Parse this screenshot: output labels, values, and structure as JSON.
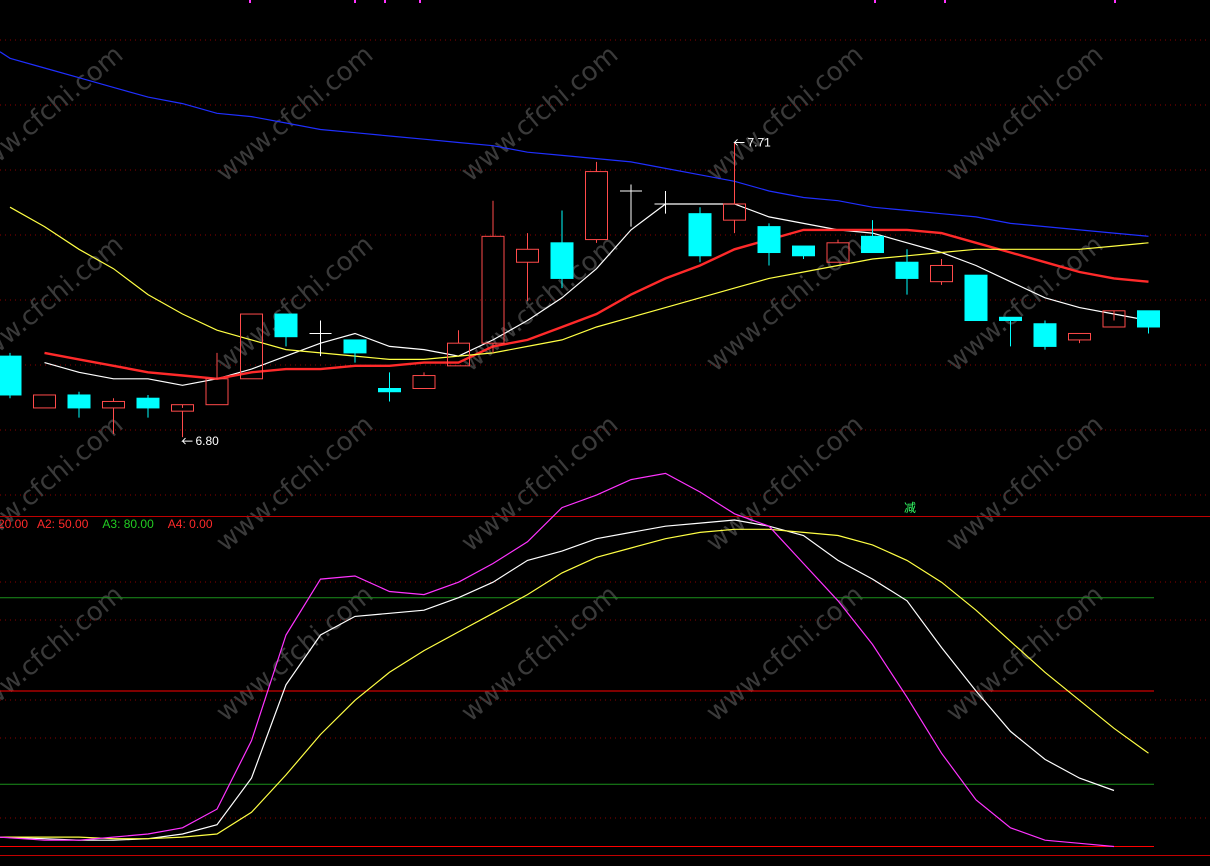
{
  "colors": {
    "background": "#000000",
    "up_candle": "#ff4a4a",
    "down_candle": "#00ffff",
    "doji_candle": "#ffffff",
    "grid_dotted": "#8b0000",
    "separator": "#c00000",
    "ma_short": "#ffffff",
    "ma_mid": "#ff2a2a",
    "ma_long": "#ffff44",
    "ma_longest": "#1f2fff",
    "kdj_k": "#ffffff",
    "kdj_d": "#ffff44",
    "kdj_j": "#ff33ff",
    "level_green": "#1a8f1a",
    "level_red": "#ff0000",
    "signal_text": "#33ff66",
    "watermark": "#3a3a3a"
  },
  "watermark_text": "www.cfchi.com",
  "signal_label": "减",
  "legend": [
    {
      "text": "20.00",
      "color": "#ff2a2a"
    },
    {
      "text": "A2: 50.00",
      "color": "#ff2a2a"
    },
    {
      "text": "A3: 80.00",
      "color": "#22cc22"
    },
    {
      "text": "A4: 0.00",
      "color": "#ff2a2a"
    }
  ],
  "chart_data": [
    {
      "type": "candlestick",
      "title": "",
      "price_range": [
        6.55,
        8.15
      ],
      "annotations": [
        {
          "text": "7.71",
          "candle_index": 21,
          "value": 7.71,
          "kind": "high"
        },
        {
          "text": "6.80",
          "candle_index": 5,
          "value": 6.8,
          "kind": "low"
        }
      ],
      "candles": [
        {
          "o": 7.05,
          "h": 7.06,
          "c": 6.93,
          "l": 6.92
        },
        {
          "o": 6.89,
          "h": 6.93,
          "c": 6.93,
          "l": 6.89
        },
        {
          "o": 6.93,
          "h": 6.94,
          "c": 6.89,
          "l": 6.86
        },
        {
          "o": 6.89,
          "h": 6.92,
          "c": 6.91,
          "l": 6.81
        },
        {
          "o": 6.92,
          "h": 6.93,
          "c": 6.89,
          "l": 6.86
        },
        {
          "o": 6.88,
          "h": 6.89,
          "c": 6.9,
          "l": 6.8
        },
        {
          "o": 6.9,
          "h": 7.06,
          "c": 6.98,
          "l": 6.9
        },
        {
          "o": 6.98,
          "h": 7.18,
          "c": 7.18,
          "l": 6.98
        },
        {
          "o": 7.18,
          "h": 7.18,
          "c": 7.11,
          "l": 7.08
        },
        {
          "o": 7.12,
          "h": 7.16,
          "c": 7.12,
          "l": 7.05
        },
        {
          "o": 7.1,
          "h": 7.1,
          "c": 7.06,
          "l": 7.03
        },
        {
          "o": 6.95,
          "h": 7.0,
          "c": 6.94,
          "l": 6.91
        },
        {
          "o": 6.95,
          "h": 7.0,
          "c": 6.99,
          "l": 6.95
        },
        {
          "o": 7.02,
          "h": 7.13,
          "c": 7.09,
          "l": 7.02
        },
        {
          "o": 7.09,
          "h": 7.53,
          "c": 7.42,
          "l": 7.06
        },
        {
          "o": 7.34,
          "h": 7.43,
          "c": 7.38,
          "l": 7.22
        },
        {
          "o": 7.4,
          "h": 7.5,
          "c": 7.29,
          "l": 7.26
        },
        {
          "o": 7.41,
          "h": 7.65,
          "c": 7.62,
          "l": 7.4
        },
        {
          "o": 7.56,
          "h": 7.58,
          "c": 7.56,
          "l": 7.45
        },
        {
          "o": 7.52,
          "h": 7.56,
          "c": 7.52,
          "l": 7.49
        },
        {
          "o": 7.49,
          "h": 7.51,
          "c": 7.36,
          "l": 7.34
        },
        {
          "o": 7.47,
          "h": 7.71,
          "c": 7.52,
          "l": 7.43
        },
        {
          "o": 7.45,
          "h": 7.46,
          "c": 7.37,
          "l": 7.33
        },
        {
          "o": 7.39,
          "h": 7.39,
          "c": 7.36,
          "l": 7.35
        },
        {
          "o": 7.34,
          "h": 7.41,
          "c": 7.4,
          "l": 7.34
        },
        {
          "o": 7.42,
          "h": 7.47,
          "c": 7.37,
          "l": 7.37
        },
        {
          "o": 7.34,
          "h": 7.38,
          "c": 7.29,
          "l": 7.24
        },
        {
          "o": 7.28,
          "h": 7.35,
          "c": 7.33,
          "l": 7.27
        },
        {
          "o": 7.3,
          "h": 7.3,
          "c": 7.16,
          "l": 7.16
        },
        {
          "o": 7.17,
          "h": 7.17,
          "c": 7.16,
          "l": 7.08
        },
        {
          "o": 7.15,
          "h": 7.16,
          "c": 7.08,
          "l": 7.07
        },
        {
          "o": 7.1,
          "h": 7.12,
          "c": 7.12,
          "l": 7.09
        },
        {
          "o": 7.14,
          "h": 7.16,
          "c": 7.19,
          "l": 7.14
        },
        {
          "o": 7.19,
          "h": 7.19,
          "c": 7.14,
          "l": 7.12
        }
      ],
      "series": [
        {
          "name": "",
          "color": "#ffffff",
          "values": [
            null,
            7.03,
            7.0,
            6.98,
            6.98,
            6.96,
            6.98,
            7.01,
            7.05,
            7.09,
            7.12,
            7.08,
            7.07,
            7.05,
            7.1,
            7.16,
            7.23,
            7.32,
            7.44,
            7.52,
            7.52,
            7.52,
            7.48,
            7.46,
            7.44,
            7.43,
            7.4,
            7.37,
            7.33,
            7.28,
            7.23,
            7.2,
            7.18,
            7.16
          ]
        },
        {
          "name": "",
          "color": "#ff2a2a",
          "values": [
            null,
            7.06,
            7.04,
            7.02,
            7.0,
            6.99,
            6.98,
            7.0,
            7.01,
            7.01,
            7.02,
            7.02,
            7.03,
            7.03,
            7.08,
            7.1,
            7.14,
            7.18,
            7.24,
            7.29,
            7.33,
            7.38,
            7.41,
            7.44,
            7.44,
            7.44,
            7.44,
            7.43,
            7.4,
            7.37,
            7.34,
            7.31,
            7.29,
            7.28
          ]
        },
        {
          "name": "",
          "color": "#ffff44",
          "values": [
            7.51,
            7.45,
            7.38,
            7.32,
            7.24,
            7.18,
            7.13,
            7.1,
            7.07,
            7.06,
            7.05,
            7.04,
            7.04,
            7.05,
            7.06,
            7.08,
            7.1,
            7.14,
            7.17,
            7.2,
            7.23,
            7.26,
            7.29,
            7.31,
            7.33,
            7.35,
            7.36,
            7.37,
            7.38,
            7.38,
            7.38,
            7.38,
            7.39,
            7.4
          ]
        },
        {
          "name": "",
          "color": "#1f2fff",
          "values": [
            7.97,
            7.94,
            7.91,
            7.88,
            7.85,
            7.83,
            7.8,
            7.79,
            7.77,
            7.75,
            7.74,
            7.73,
            7.72,
            7.71,
            7.7,
            7.68,
            7.67,
            7.66,
            7.65,
            7.63,
            7.61,
            7.59,
            7.56,
            7.54,
            7.53,
            7.51,
            7.5,
            7.49,
            7.48,
            7.46,
            7.45,
            7.44,
            7.43,
            7.42
          ]
        }
      ]
    },
    {
      "type": "line",
      "title": "",
      "ylim": [
        -5,
        105
      ],
      "levels": [
        {
          "value": 80,
          "color": "#1a8f1a"
        },
        {
          "value": 50,
          "color": "#ff0000"
        },
        {
          "value": 20,
          "color": "#1a8f1a"
        },
        {
          "value": 0,
          "color": "#ff0000"
        }
      ],
      "series": [
        {
          "name": "",
          "color": "#ffffff",
          "values": [
            3,
            2.5,
            2,
            2,
            2.5,
            4,
            7,
            22,
            52,
            68,
            74,
            75,
            76,
            80,
            85,
            92,
            95,
            99,
            101,
            103,
            104,
            105,
            103,
            100,
            92,
            86,
            79,
            64,
            50,
            37,
            28,
            22,
            18
          ]
        },
        {
          "name": "",
          "color": "#ffff44",
          "values": [
            3,
            3,
            3,
            2.5,
            2.5,
            3,
            4,
            11,
            23,
            36,
            47,
            56,
            63,
            69,
            75,
            81,
            88,
            93,
            96,
            99,
            101,
            102,
            102,
            101,
            100,
            97,
            92,
            85,
            76,
            66,
            56,
            47,
            38,
            30
          ]
        },
        {
          "name": "",
          "color": "#ff33ff",
          "values": [
            3,
            2,
            2,
            3,
            4,
            6,
            12,
            34,
            68,
            86,
            87,
            82,
            81,
            85,
            91,
            98,
            109,
            113,
            118,
            120,
            114,
            107,
            103,
            91,
            79,
            65,
            48,
            30,
            15,
            6,
            2,
            1,
            0
          ]
        }
      ]
    }
  ]
}
